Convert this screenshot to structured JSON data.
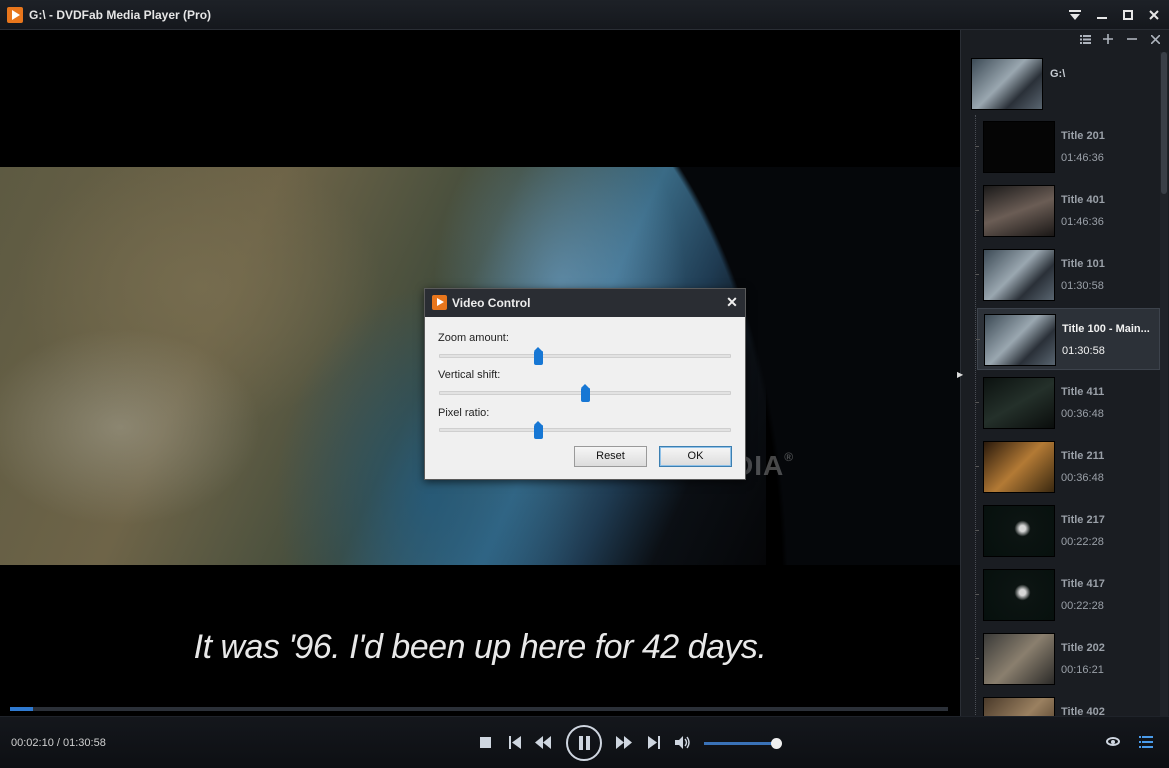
{
  "window": {
    "title": "G:\\ - DVDFab Media Player (Pro)",
    "controls": [
      "menu-down",
      "minimize",
      "maximize",
      "close"
    ]
  },
  "player": {
    "subtitle": "It was '96. I'd been up here for 42 days.",
    "watermark": "SOFTPEDIA",
    "watermark_mark": "®",
    "progress_fraction": 0.024,
    "time": {
      "current": "00:02:10",
      "total": "01:30:58",
      "display": "00:02:10 / 01:30:58"
    },
    "volume_fraction": 0.92
  },
  "controls": {
    "icons": [
      "stop-icon",
      "previous-icon",
      "rewind-icon",
      "pause-icon",
      "fast-forward-icon",
      "next-icon",
      "volume-icon",
      "eye-icon",
      "playlist-icon"
    ]
  },
  "sidebar": {
    "source": {
      "label": "G:\\"
    },
    "toolbar": [
      "list-icon",
      "add-icon",
      "remove-icon",
      "close-icon"
    ],
    "titles": [
      {
        "name": "Title 201",
        "duration": "01:46:36",
        "selected": false
      },
      {
        "name": "Title 401",
        "duration": "01:46:36",
        "selected": false
      },
      {
        "name": "Title 101",
        "duration": "01:30:58",
        "selected": false
      },
      {
        "name": "Title 100 - Main...",
        "duration": "01:30:58",
        "selected": true
      },
      {
        "name": "Title 411",
        "duration": "00:36:48",
        "selected": false
      },
      {
        "name": "Title 211",
        "duration": "00:36:48",
        "selected": false
      },
      {
        "name": "Title 217",
        "duration": "00:22:28",
        "selected": false
      },
      {
        "name": "Title 417",
        "duration": "00:22:28",
        "selected": false
      },
      {
        "name": "Title 202",
        "duration": "00:16:21",
        "selected": false
      },
      {
        "name": "Title 402",
        "duration": "",
        "selected": false
      }
    ]
  },
  "dialog": {
    "title": "Video Control",
    "zoom_label": "Zoom amount:",
    "zoom_value": 0.34,
    "vshift_label": "Vertical shift:",
    "vshift_value": 0.5,
    "pixel_label": "Pixel ratio:",
    "pixel_value": 0.34,
    "reset_label": "Reset",
    "ok_label": "OK"
  },
  "colors": {
    "accent": "#2f7ad1",
    "logo": "#e8761c",
    "slider_thumb": "#1777d4"
  }
}
